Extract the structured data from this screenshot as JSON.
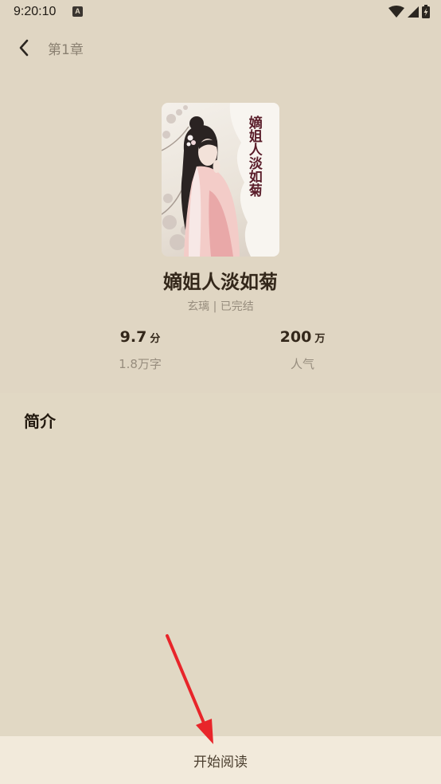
{
  "status_bar": {
    "time": "9:20:10",
    "notification_icon": "A"
  },
  "header": {
    "back_icon": "chevron-left-icon",
    "chapter_title": "第1章"
  },
  "book": {
    "cover_title": "嫡姐人淡如菊",
    "title": "嫡姐人淡如菊",
    "meta": "玄璃 | 已完结",
    "stats": [
      {
        "value": "9.7",
        "unit": "分",
        "label": "1.8万字"
      },
      {
        "value": "200",
        "unit": "万",
        "label": "人气"
      }
    ]
  },
  "intro": {
    "heading": "简介"
  },
  "bottom_bar": {
    "start_reading_label": "开始阅读"
  },
  "colors": {
    "background": "#e0d6c3",
    "bottom_bar": "#f2eadb",
    "annotation_arrow": "#e8252a"
  }
}
